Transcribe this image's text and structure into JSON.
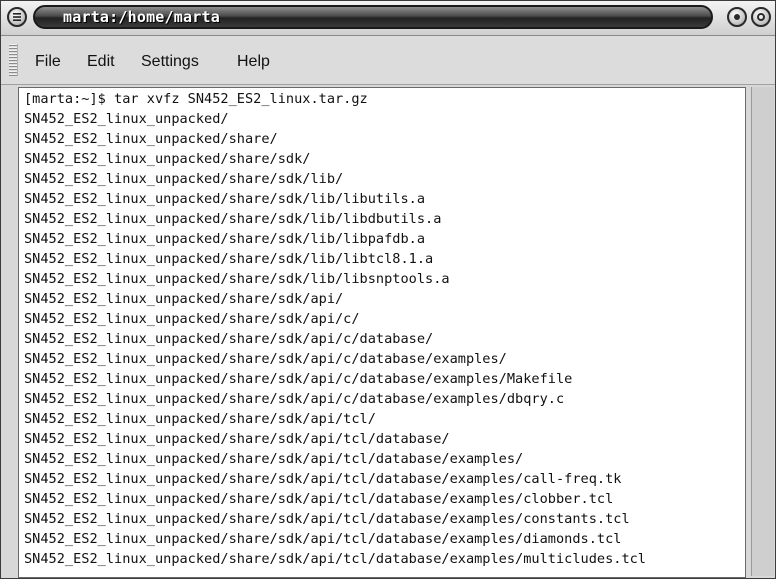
{
  "window": {
    "title": "marta:/home/marta"
  },
  "menu": {
    "file": "File",
    "edit": "Edit",
    "settings": "Settings",
    "help": "Help"
  },
  "terminal": {
    "lines": [
      "[marta:~]$ tar xvfz SN452_ES2_linux.tar.gz",
      "SN452_ES2_linux_unpacked/",
      "SN452_ES2_linux_unpacked/share/",
      "SN452_ES2_linux_unpacked/share/sdk/",
      "SN452_ES2_linux_unpacked/share/sdk/lib/",
      "SN452_ES2_linux_unpacked/share/sdk/lib/libutils.a",
      "SN452_ES2_linux_unpacked/share/sdk/lib/libdbutils.a",
      "SN452_ES2_linux_unpacked/share/sdk/lib/libpafdb.a",
      "SN452_ES2_linux_unpacked/share/sdk/lib/libtcl8.1.a",
      "SN452_ES2_linux_unpacked/share/sdk/lib/libsnptools.a",
      "SN452_ES2_linux_unpacked/share/sdk/api/",
      "SN452_ES2_linux_unpacked/share/sdk/api/c/",
      "SN452_ES2_linux_unpacked/share/sdk/api/c/database/",
      "SN452_ES2_linux_unpacked/share/sdk/api/c/database/examples/",
      "SN452_ES2_linux_unpacked/share/sdk/api/c/database/examples/Makefile",
      "SN452_ES2_linux_unpacked/share/sdk/api/c/database/examples/dbqry.c",
      "SN452_ES2_linux_unpacked/share/sdk/api/tcl/",
      "SN452_ES2_linux_unpacked/share/sdk/api/tcl/database/",
      "SN452_ES2_linux_unpacked/share/sdk/api/tcl/database/examples/",
      "SN452_ES2_linux_unpacked/share/sdk/api/tcl/database/examples/call-freq.tk",
      "SN452_ES2_linux_unpacked/share/sdk/api/tcl/database/examples/clobber.tcl",
      "SN452_ES2_linux_unpacked/share/sdk/api/tcl/database/examples/constants.tcl",
      "SN452_ES2_linux_unpacked/share/sdk/api/tcl/database/examples/diamonds.tcl",
      "SN452_ES2_linux_unpacked/share/sdk/api/tcl/database/examples/multicludes.tcl"
    ]
  }
}
